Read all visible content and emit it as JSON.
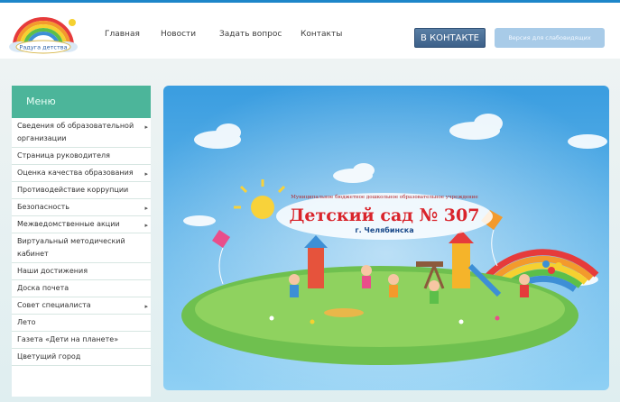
{
  "header": {
    "logo_text": "Радуга детства",
    "nav": [
      {
        "label": "Главная"
      },
      {
        "label": "Новости"
      },
      {
        "label": "Задать вопрос"
      },
      {
        "label": "Контакты"
      }
    ],
    "vk_label": "В КОНТАКТЕ",
    "vis_label": "Версия для слабовидящих"
  },
  "menu": {
    "title": "Меню",
    "items": [
      {
        "label": "Сведения об образовательной организации",
        "has_submenu": true
      },
      {
        "label": "Страница руководителя",
        "has_submenu": false
      },
      {
        "label": "Оценка качества образования",
        "has_submenu": true
      },
      {
        "label": "Противодействие коррупции",
        "has_submenu": false
      },
      {
        "label": "Безопасность",
        "has_submenu": true
      },
      {
        "label": "Межведомственные акции",
        "has_submenu": true
      },
      {
        "label": "Виртуальный методический кабинет",
        "has_submenu": false
      },
      {
        "label": "Наши достижения",
        "has_submenu": false
      },
      {
        "label": "Доска почета",
        "has_submenu": false
      },
      {
        "label": "Совет специалиста",
        "has_submenu": true
      },
      {
        "label": "Лето",
        "has_submenu": false
      },
      {
        "label": "Газета «Дети на планете»",
        "has_submenu": false
      },
      {
        "label": "Цветущий город",
        "has_submenu": false
      }
    ]
  },
  "banner": {
    "subtitle": "Муниципальное бюджетное дошкольное образовательное учреждение",
    "title": "Детский сад № 307",
    "city": "г. Челябинска"
  },
  "colors": {
    "accent": "#1e86c9",
    "menu_header": "#4cb59a",
    "vk_button": "#4a6f98",
    "title_red": "#d9242b"
  }
}
